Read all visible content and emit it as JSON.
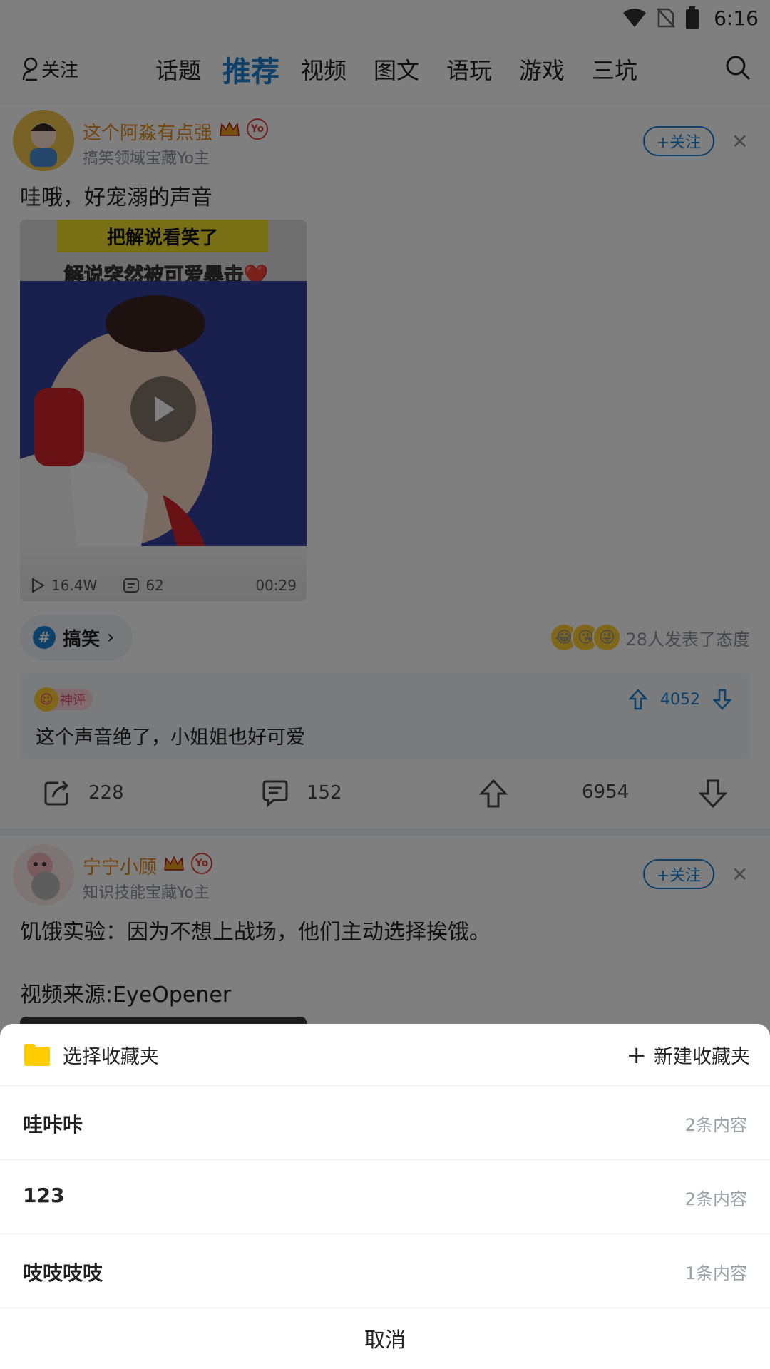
{
  "status_bar": {
    "time": "6:16"
  },
  "top_nav": {
    "follow_label": "关注",
    "tabs": [
      {
        "label": "话题"
      },
      {
        "label": "推荐"
      },
      {
        "label": "视频"
      },
      {
        "label": "图文"
      },
      {
        "label": "语玩"
      },
      {
        "label": "游戏"
      },
      {
        "label": "三坑"
      }
    ],
    "active_tab": "推荐",
    "accent_color": "#1c82d4"
  },
  "posts": [
    {
      "author": "这个阿淼有点强",
      "subtitle": "搞笑领域宝藏Yo主",
      "badge": "Yo",
      "follow_label": "+关注",
      "text": "哇哦，好宠溺的声音",
      "video": {
        "caption_line1": "把解说看笑了",
        "caption_line2": "解说突然被可爱暴击❤️",
        "plays": "16.4W",
        "danmaku": "62",
        "duration": "00:29"
      },
      "topic": "搞笑",
      "reactions_text": "28人发表了态度",
      "god_comment": {
        "badge": "神评",
        "text": "这个声音绝了，小姐姐也好可爱",
        "votes": "4052"
      },
      "actions": {
        "share": "228",
        "comment": "152",
        "upvote": "6954"
      }
    },
    {
      "author": "宁宁小顾",
      "subtitle": "知识技能宝藏Yo主",
      "badge": "Yo",
      "follow_label": "+关注",
      "text_line1": "饥饿实验：因为不想上战场，他们主动选择挨饿。",
      "text_line2": "视频来源:EyeOpener"
    }
  ],
  "sheet": {
    "title": "选择收藏夹",
    "new_label": "新建收藏夹",
    "folders": [
      {
        "name": "哇咔咔",
        "count": "2条内容"
      },
      {
        "name": "123",
        "count": "2条内容"
      },
      {
        "name": "吱吱吱吱",
        "count": "1条内容"
      }
    ],
    "cancel": "取消",
    "folder_color": "#ffcc00"
  }
}
